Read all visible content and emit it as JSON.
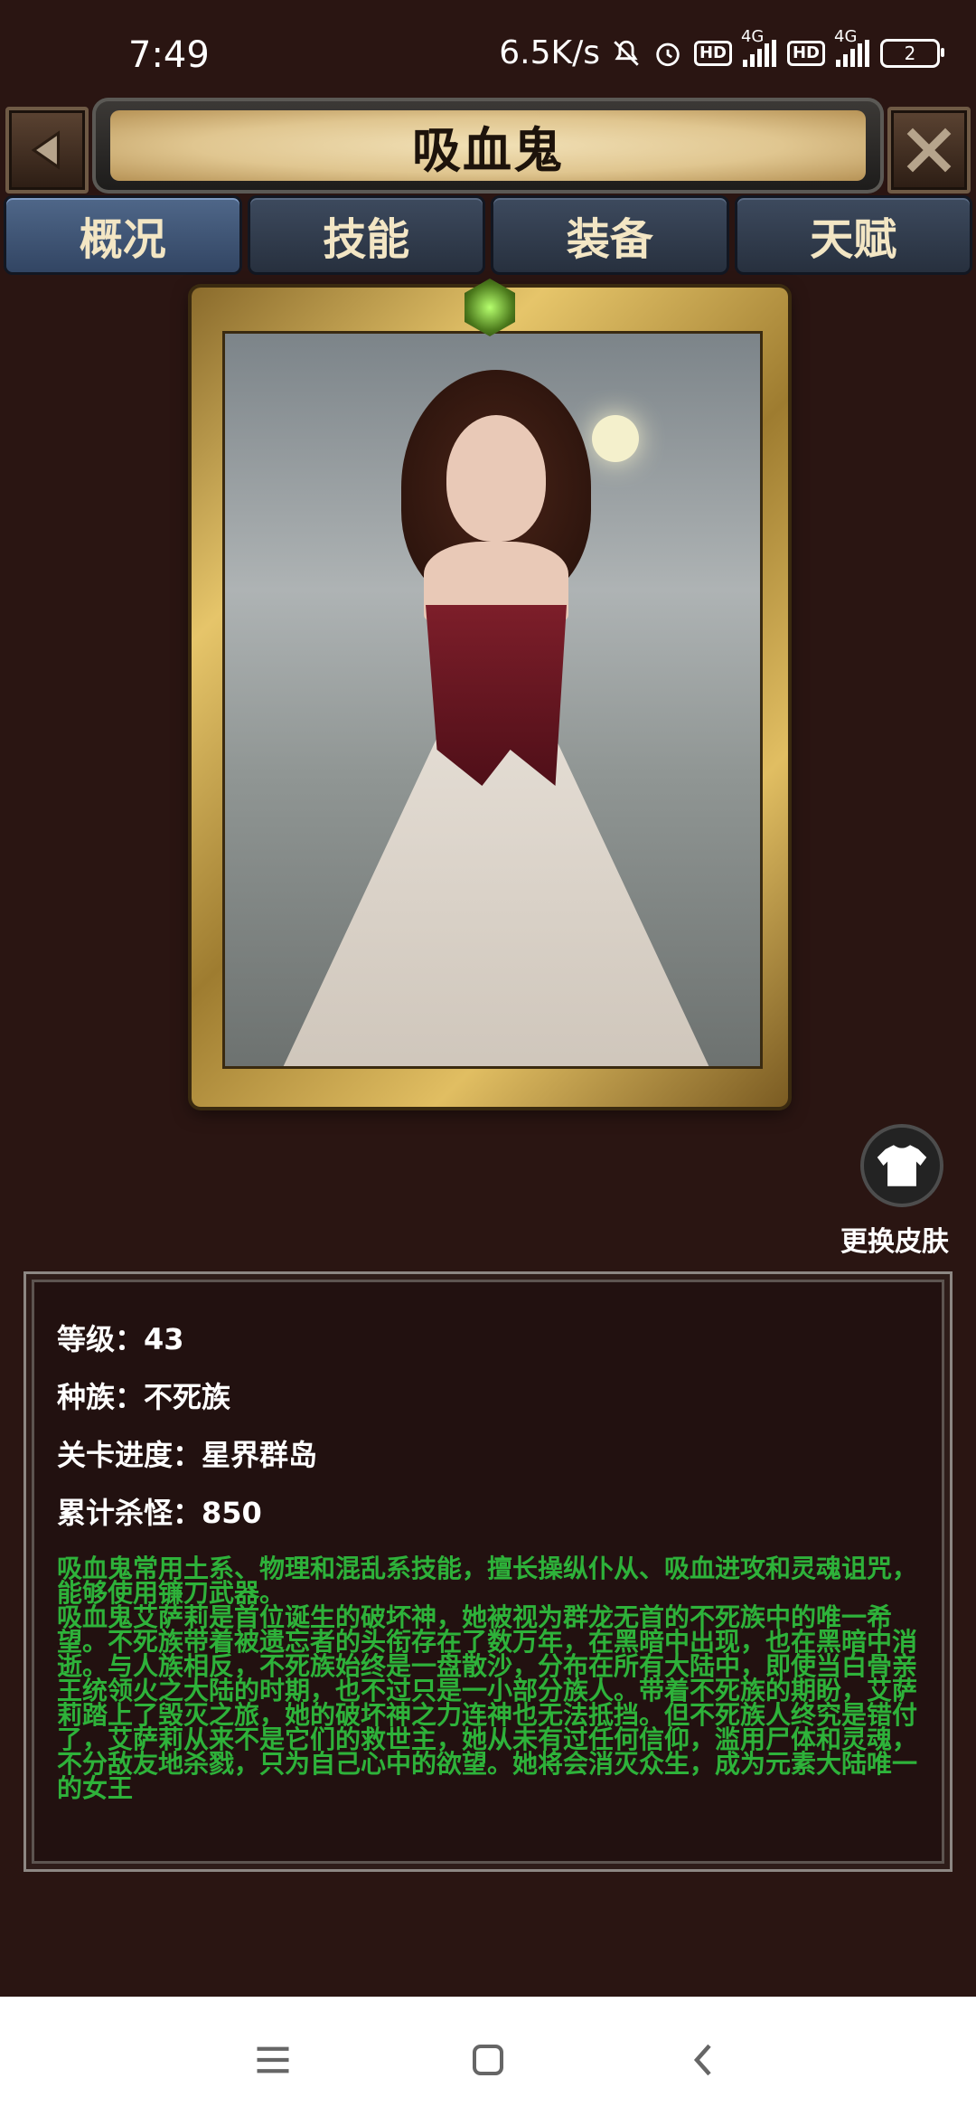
{
  "status_bar": {
    "time": "7:49",
    "speed": "6.5K/s",
    "network_1": "4G",
    "network_2": "4G",
    "hd_label": "HD",
    "battery": "2"
  },
  "header": {
    "title": "吸血鬼",
    "back_icon": "back-arrow-icon",
    "close_icon": "close-icon"
  },
  "tabs": [
    {
      "label": "概况",
      "active": true
    },
    {
      "label": "技能",
      "active": false
    },
    {
      "label": "装备",
      "active": false
    },
    {
      "label": "天赋",
      "active": false
    }
  ],
  "skin": {
    "label": "更换皮肤",
    "icon": "shirt-icon"
  },
  "stats": {
    "level": "等级：43",
    "race": "种族：不死族",
    "progress": "关卡进度：星界群岛",
    "kills": "累计杀怪：850"
  },
  "description": {
    "line1": "吸血鬼常用土系、物理和混乱系技能，擅长操纵仆从、吸血进攻和灵魂诅咒，能够使用镰刀武器。",
    "line2": "吸血鬼艾萨莉是首位诞生的破坏神，她被视为群龙无首的不死族中的唯一希望。不死族带着被遗忘者的头衔存在了数万年，在黑暗中出现，也在黑暗中消逝。与人族相反，不死族始终是一盘散沙，分布在所有大陆中，即使当白骨亲王统领火之大陆的时期，也不过只是一小部分族人。带着不死族的期盼，艾萨莉踏上了毁灭之旅，她的破坏神之力连神也无法抵挡。但不死族人终究是错付了，艾萨莉从来不是它们的救世主，她从未有过任何信仰，滥用尸体和灵魂，不分敌友地杀戮，只为自己心中的欲望。她将会消灭众生，成为元素大陆唯一的女王"
  },
  "nav": {
    "menu_icon": "menu-icon",
    "home_icon": "home-icon",
    "back_icon": "back-icon"
  },
  "colors": {
    "background": "#2a1512",
    "description_text": "#2eb23a",
    "title_scroll": "#e0c690",
    "tab_active": "#4f6789"
  }
}
